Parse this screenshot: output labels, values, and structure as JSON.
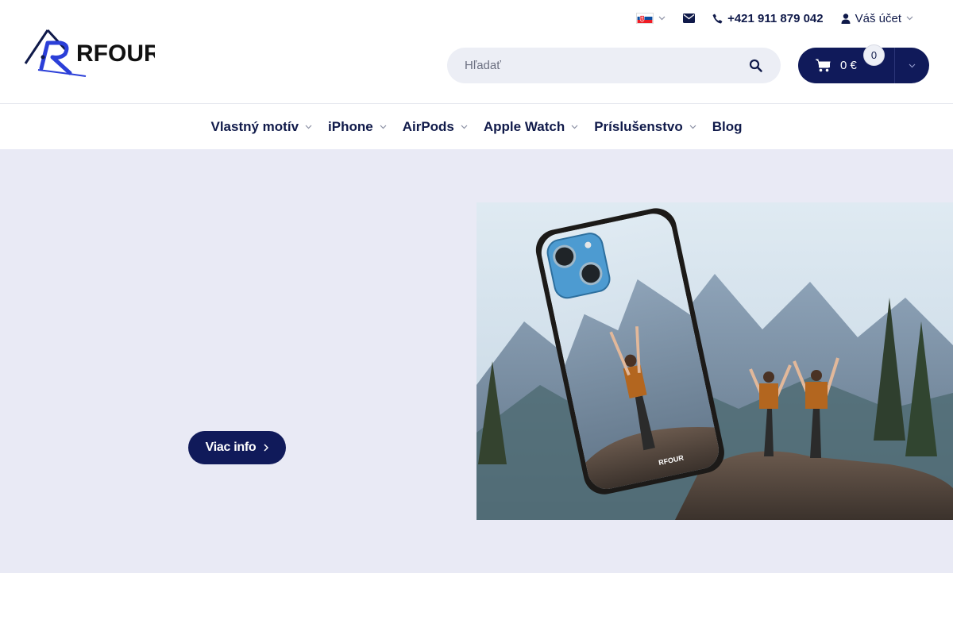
{
  "header": {
    "logo_text": "RFOUR",
    "language": {
      "code": "SK",
      "colors": {
        "white": "#ffffff",
        "blue": "#0b4ea2",
        "red": "#ee1c25"
      }
    },
    "phone": "+421 911 879 042",
    "account_label": "Váš účet",
    "search": {
      "placeholder": "Hľadať"
    },
    "cart": {
      "amount": "0 €",
      "count": "0"
    }
  },
  "nav": {
    "items": [
      {
        "label": "Vlastný motív",
        "has_dropdown": true
      },
      {
        "label": "iPhone",
        "has_dropdown": true
      },
      {
        "label": "AirPods",
        "has_dropdown": true
      },
      {
        "label": "Apple Watch",
        "has_dropdown": true
      },
      {
        "label": "Príslušenstvo",
        "has_dropdown": true
      },
      {
        "label": "Blog",
        "has_dropdown": false
      }
    ]
  },
  "hero": {
    "button_label": "Viac info",
    "case_brand_text": "RFOUR"
  },
  "colors": {
    "brand_navy": "#101a5a",
    "hero_background": "#e9eaf5",
    "accent_blue": "#2b3fd8"
  }
}
